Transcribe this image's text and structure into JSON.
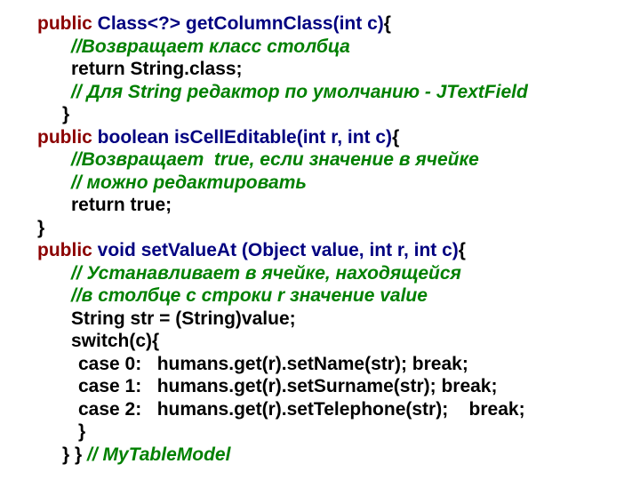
{
  "lines": {
    "l1_pub": "public ",
    "l1_sig": "Class<?> getColumnClass(int c)",
    "l1_brace": "{",
    "l2": "//Возвращает класс столбца",
    "l3": "return String.class;",
    "l4": "// Для String редактор по умолчанию - JTextField",
    "l5": "}",
    "l6_pub": "public ",
    "l6_bool": "boolean ",
    "l6_name": "isCellEditable(int r, int c)",
    "l6_brace": "{",
    "l7": "//Возвращает  true, если значение в ячейке",
    "l8": "// можно редактировать",
    "l9": "return true;",
    "l10": "}",
    "l11_pub": "public ",
    "l11_void": "void ",
    "l11_name": "setValueAt (Object value, int r, int c)",
    "l11_brace": "{",
    "l12": "// Устанавливает в ячейке, находящейся",
    "l13": "//в столбце c строки r значение value",
    "l14": "String str = (String)value;",
    "l15": "switch(c){",
    "l16": "case 0:   humans.get(r).setName(str); break;",
    "l17": "case 1:   humans.get(r).setSurname(str); break;",
    "l18": "case 2:   humans.get(r).setTelephone(str);    break;",
    "l19": "}",
    "l20a": "} } ",
    "l20b": "// MyTableModel"
  }
}
